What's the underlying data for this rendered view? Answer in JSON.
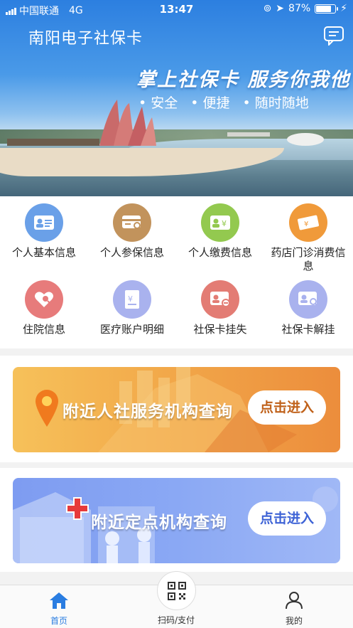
{
  "status_bar": {
    "carrier": "中国联通",
    "network": "4G",
    "time": "13:47",
    "battery": "87%"
  },
  "header": {
    "title": "南阳电子社保卡"
  },
  "hero": {
    "slogan": "掌上社保卡 服务你我他",
    "bullets": [
      "安全",
      "便捷",
      "随时随地"
    ]
  },
  "grid": {
    "items": [
      {
        "label": "个人基本信息",
        "icon": "id-card-icon",
        "color": "#6aa0e8"
      },
      {
        "label": "个人参保信息",
        "icon": "insurance-card-search-icon",
        "color": "#c2935c"
      },
      {
        "label": "个人缴费信息",
        "icon": "payment-card-icon",
        "color": "#93c94f"
      },
      {
        "label": "药店门诊消费信息",
        "icon": "ticket-icon",
        "color": "#f09a3a"
      },
      {
        "label": "住院信息",
        "icon": "heart-search-icon",
        "color": "#e77b7b"
      },
      {
        "label": "医疗账户明细",
        "icon": "medical-bill-icon",
        "color": "#a9b2ee"
      },
      {
        "label": "社保卡挂失",
        "icon": "card-report-loss-icon",
        "color": "#e37c74"
      },
      {
        "label": "社保卡解挂",
        "icon": "card-unlock-icon",
        "color": "#a9b2ee"
      }
    ]
  },
  "banners": [
    {
      "text": "附近人社服务机构查询",
      "button": "点击进入",
      "icon": "location-pin-icon"
    },
    {
      "text": "附近定点机构查询",
      "button": "点击进入",
      "icon": "medical-cross-icon"
    }
  ],
  "tabbar": {
    "home": "首页",
    "scan": "扫码/支付",
    "me": "我的",
    "active_color": "#2a7de1"
  }
}
